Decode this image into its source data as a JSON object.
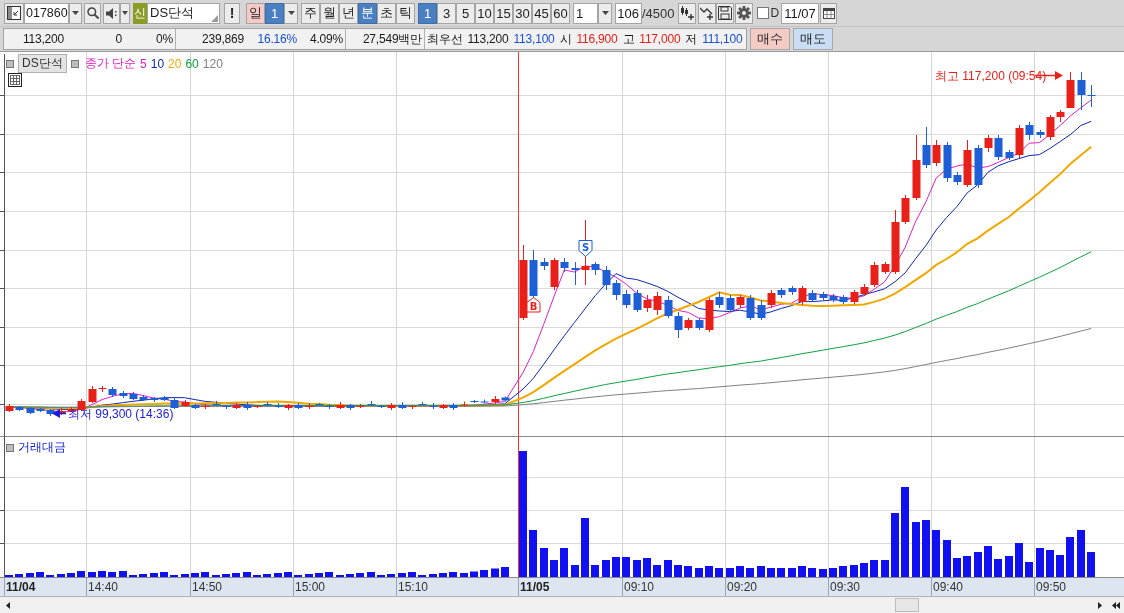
{
  "toolbar": {
    "stock_code": "017860",
    "market_badge": "신",
    "stock_name": "DS단석",
    "alert_label": "!",
    "day_label": "일",
    "day_count": "1",
    "periods": [
      {
        "label": "주",
        "selected": false
      },
      {
        "label": "월",
        "selected": false
      },
      {
        "label": "년",
        "selected": false
      },
      {
        "label": "분",
        "selected": true
      },
      {
        "label": "초",
        "selected": false
      },
      {
        "label": "틱",
        "selected": false
      }
    ],
    "intervals": [
      {
        "label": "1",
        "selected": true
      },
      {
        "label": "3",
        "selected": false
      },
      {
        "label": "5",
        "selected": false
      },
      {
        "label": "10",
        "selected": false
      },
      {
        "label": "15",
        "selected": false
      },
      {
        "label": "30",
        "selected": false
      },
      {
        "label": "45",
        "selected": false
      },
      {
        "label": "60",
        "selected": false
      }
    ],
    "interval_value": "1",
    "count_value": "106",
    "count_total": "/4500",
    "d_checkbox": {
      "label": "D",
      "checked": false
    },
    "date_value": "11/07"
  },
  "quote_bar": {
    "groups": [
      {
        "items": [
          {
            "text": "113,200"
          },
          {
            "text": "0"
          },
          {
            "text": "0%"
          }
        ]
      },
      {
        "items": [
          {
            "text": "239,869"
          },
          {
            "text": "16.16%",
            "color": "#1a4fd0"
          },
          {
            "text": "4.09%"
          }
        ]
      },
      {
        "items": [
          {
            "text": "27,549백만"
          }
        ]
      },
      {
        "items": [
          {
            "text": "최우선"
          },
          {
            "text": "113,200"
          },
          {
            "text": "113,100",
            "color": "#1a4fd0"
          },
          {
            "text": "시"
          },
          {
            "text": "116,900",
            "color": "#e8201a"
          },
          {
            "text": "고"
          },
          {
            "text": "117,000",
            "color": "#e8201a"
          },
          {
            "text": "저"
          },
          {
            "text": "111,100",
            "color": "#1a4fd0"
          }
        ]
      }
    ]
  },
  "order_buttons": [
    {
      "kind": "buy",
      "label": "매수"
    },
    {
      "kind": "sell",
      "label": "매도"
    }
  ],
  "chart": {
    "legend": {
      "title": "DS단석",
      "indicator": "종가 단순",
      "series": [
        {
          "label": "5",
          "color": "#e020c0"
        },
        {
          "label": "10",
          "color": "#1028b0"
        },
        {
          "label": "20",
          "color": "#f0a800"
        },
        {
          "label": "60",
          "color": "#10a040"
        },
        {
          "label": "120",
          "color": "#808080"
        }
      ]
    },
    "high_marker": "최고 117,200 (09:54)",
    "low_marker": "최저 99,300 (14:36)",
    "signals": [
      {
        "kind": "buy",
        "label": "B"
      },
      {
        "kind": "sell",
        "label": "S"
      }
    ],
    "volume_title": "거래대금",
    "time_axis": [
      {
        "label": "11/04",
        "kind": "date"
      },
      {
        "label": "14:40",
        "kind": "time"
      },
      {
        "label": "14:50",
        "kind": "time"
      },
      {
        "label": "15:00",
        "kind": "time"
      },
      {
        "label": "15:10",
        "kind": "time"
      },
      {
        "label": "11/05",
        "kind": "date"
      },
      {
        "label": "09:10",
        "kind": "time"
      },
      {
        "label": "09:20",
        "kind": "time"
      },
      {
        "label": "09:30",
        "kind": "time"
      },
      {
        "label": "09:40",
        "kind": "time"
      },
      {
        "label": "09:50",
        "kind": "time"
      }
    ]
  }
}
